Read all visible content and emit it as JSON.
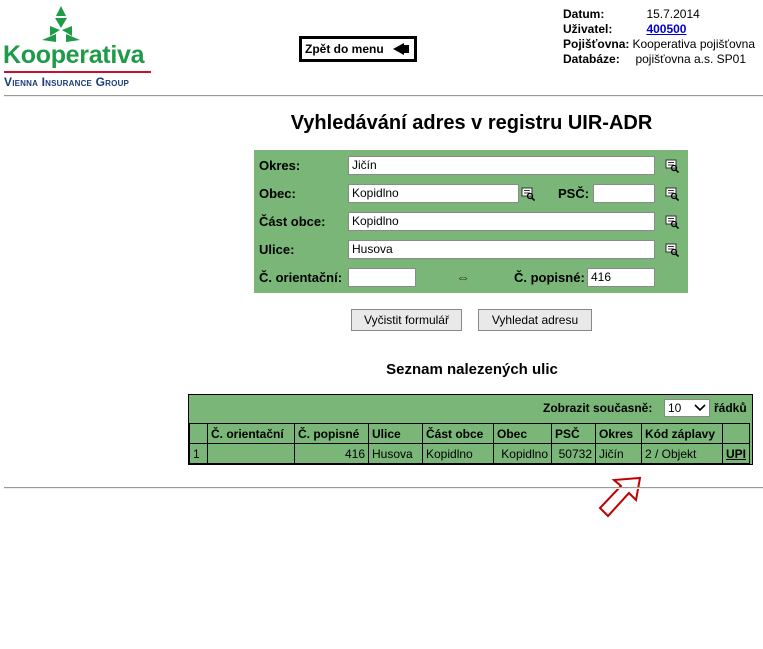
{
  "logo": {
    "name": "Kooperativa",
    "group": "Vienna Insurance Group",
    "colors": {
      "green": "#1f9a48",
      "red": "#c8102e",
      "navy": "#1a3c7a"
    }
  },
  "nav": {
    "back_label": "Zpět do menu",
    "back_icon": "left-triangle-icon"
  },
  "info": {
    "date_label": "Datum:",
    "date": "15.7.2014",
    "user_label": "Uživatel:",
    "user": "400500",
    "insurer_label": "Pojišťovna:",
    "insurer": "Kooperativa pojišťovna",
    "database_label": "Databáze:",
    "database": "pojišťovna a.s. SP01"
  },
  "page_title": "Vyhledávání adres v registru UIR-ADR",
  "form": {
    "okres": {
      "label": "Okres:",
      "value": "Jičín"
    },
    "obec": {
      "label": "Obec:",
      "value": "Kopidlno"
    },
    "psc": {
      "label": "PSČ:",
      "value": ""
    },
    "cast_obce": {
      "label": "Část obce:",
      "value": "Kopidlno"
    },
    "ulice": {
      "label": "Ulice:",
      "value": "Husova"
    },
    "c_orientacni": {
      "label": "Č. orientační:",
      "value": ""
    },
    "c_popisne": {
      "label": "Č. popisné:",
      "value": "416"
    },
    "swap_symbol": "⇔",
    "clear_label": "Vyčistit formulář",
    "search_label": "Vyhledat adresu"
  },
  "results": {
    "title": "Seznam nalezených ulic",
    "show_label": "Zobrazit současně:",
    "rows_count": "10",
    "rows_label": "řádků",
    "columns": [
      "",
      "Č. orientační",
      "Č. popisné",
      "Ulice",
      "Část obce",
      "Obec",
      "PSČ",
      "Okres",
      "Kód záplavy",
      ""
    ],
    "rows": [
      [
        "1",
        "",
        "416",
        "Husova",
        "Kopidlno",
        "Kopidlno",
        "50732",
        "Jičín",
        "2 / Objekt",
        "UPI"
      ]
    ]
  },
  "annotation": {
    "arrow_color": "#c00000"
  }
}
